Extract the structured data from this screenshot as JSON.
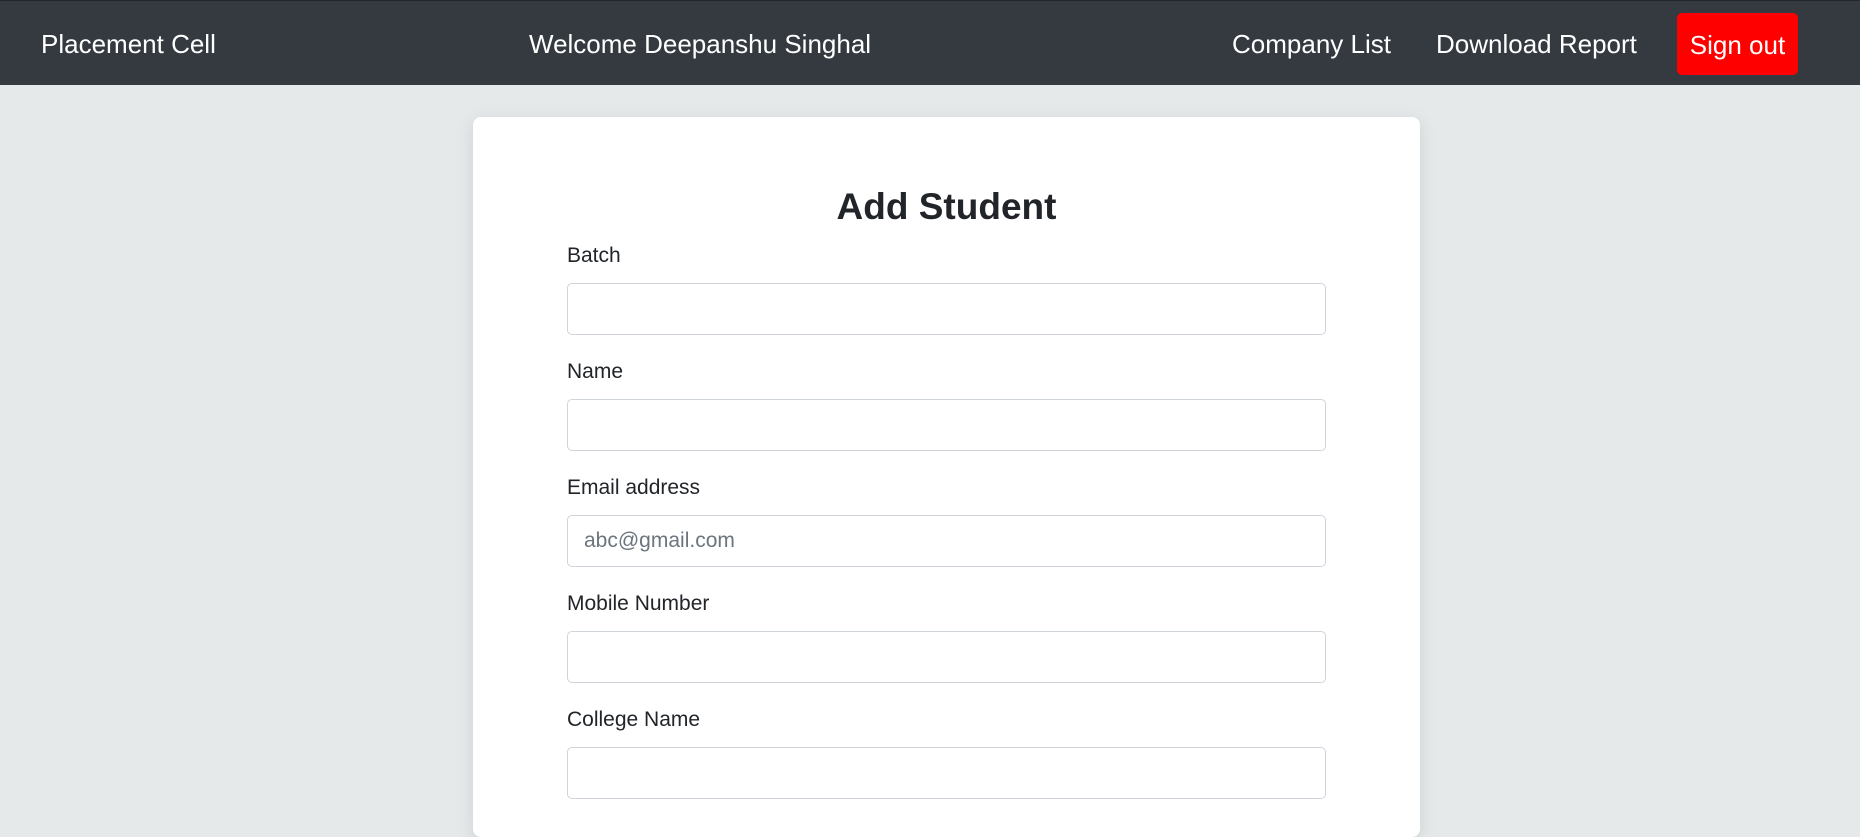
{
  "navbar": {
    "brand": "Placement Cell",
    "welcome": "Welcome Deepanshu Singhal",
    "links": {
      "company_list": "Company List",
      "download_report": "Download Report"
    },
    "signout_label": "Sign out",
    "signout_color": "#ff0000",
    "background_color": "#343a40"
  },
  "form": {
    "title": "Add Student",
    "fields": {
      "batch": {
        "label": "Batch",
        "value": "",
        "placeholder": ""
      },
      "name": {
        "label": "Name",
        "value": "",
        "placeholder": ""
      },
      "email": {
        "label": "Email address",
        "value": "",
        "placeholder": "abc@gmail.com"
      },
      "mobile": {
        "label": "Mobile Number",
        "value": "",
        "placeholder": ""
      },
      "college": {
        "label": "College Name",
        "value": "",
        "placeholder": ""
      }
    }
  }
}
